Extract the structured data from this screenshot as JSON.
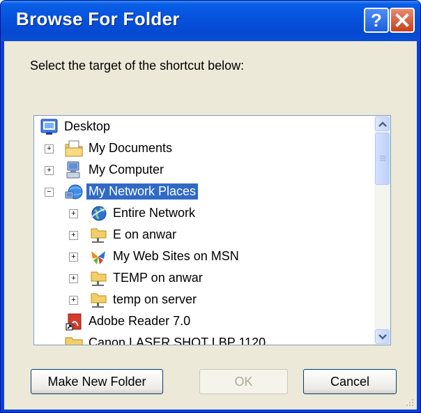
{
  "window": {
    "title": "Browse For Folder",
    "help_label": "?"
  },
  "prompt": "Select the target of the shortcut below:",
  "tree": {
    "items": [
      {
        "label": "Desktop",
        "expander": "",
        "icon": "desktop-icon"
      },
      {
        "label": "My Documents",
        "expander": "+",
        "icon": "my-documents-icon"
      },
      {
        "label": "My Computer",
        "expander": "+",
        "icon": "my-computer-icon"
      },
      {
        "label": "My Network Places",
        "expander": "−",
        "icon": "network-places-icon",
        "selected": true
      },
      {
        "label": "Entire Network",
        "expander": "+",
        "icon": "globe-icon"
      },
      {
        "label": "E on anwar",
        "expander": "+",
        "icon": "network-share-icon"
      },
      {
        "label": "My Web Sites on MSN",
        "expander": "+",
        "icon": "msn-butterfly-icon"
      },
      {
        "label": "TEMP on anwar",
        "expander": "+",
        "icon": "network-share-icon"
      },
      {
        "label": "temp on server",
        "expander": "+",
        "icon": "network-share-icon"
      },
      {
        "label": "Adobe Reader 7.0",
        "expander": "",
        "icon": "adobe-reader-icon"
      },
      {
        "label": "Canon LASER SHOT LBP 1120",
        "expander": "",
        "icon": "folder-icon"
      }
    ]
  },
  "buttons": {
    "make_new_folder": "Make New Folder",
    "ok": "OK",
    "cancel": "Cancel"
  },
  "colors": {
    "title_bar": "#0651dc",
    "selection": "#316ac5",
    "dialog_bg": "#ece9d8"
  }
}
